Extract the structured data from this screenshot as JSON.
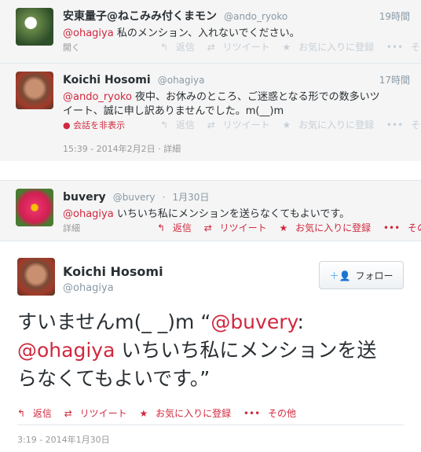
{
  "tweets": [
    {
      "name": "安東量子@ねこみみ付くまモン",
      "handle": "@ando_ryoko",
      "time": "19時間",
      "mention": "@ohagiya",
      "text": " 私のメンション、入れないでください。",
      "expand": "開く",
      "actions": {
        "reply": "返信",
        "retweet": "リツイート",
        "fav": "お気に入りに登録",
        "more": "その他"
      }
    },
    {
      "name": "Koichi Hosomi",
      "handle": "@ohagiya",
      "time": "17時間",
      "mention": "@ando_ryoko",
      "text_line1": " 夜中、お休みのところ、ご迷惑となる形での数多いツ",
      "text_line2": "イート、誠に申し訳ありませんでした。m(__)m",
      "expand": "会話を非表示",
      "timestamp": "15:39 - 2014年2月2日",
      "detail": "詳細",
      "actions": {
        "reply": "返信",
        "retweet": "リツイート",
        "fav": "お気に入りに登録",
        "more": "その他"
      }
    },
    {
      "name": "buvery",
      "handle": "@buvery",
      "time": "1月30日",
      "mention": "@ohagiya",
      "text": " いちいち私にメンションを送らなくてもよいです。",
      "detail": "詳細",
      "actions": {
        "reply": "返信",
        "retweet": "リツイート",
        "fav": "お気に入りに登録",
        "more": "その他"
      }
    }
  ],
  "main": {
    "name": "Koichi Hosomi",
    "handle": "@ohagiya",
    "follow_label": "フォロー",
    "line1_a": "すいませんm(_ _)m “",
    "line1_mention": "@buvery",
    "line1_b": ":",
    "line2_mention": "@ohagiya",
    "line2_b": " いちいち私にメンションを送",
    "line3": "らなくてもよいです。”",
    "actions": {
      "reply": "返信",
      "retweet": "リツイート",
      "fav": "お気に入りに登録",
      "more": "その他"
    },
    "timestamp": "3:19 - 2014年1月30日"
  },
  "colors": {
    "link": "#d0283e",
    "muted": "#999999",
    "bg_gray": "#f5f5f5"
  }
}
